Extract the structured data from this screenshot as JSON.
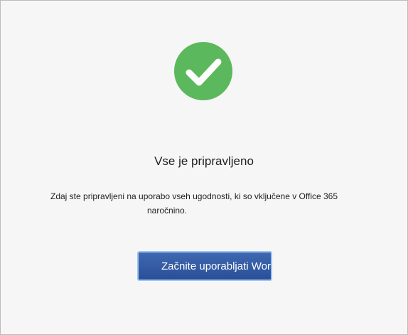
{
  "dialog": {
    "title": "Vse je pripravljeno",
    "message_line1": "Zdaj ste pripravljeni na uporabo vseh ugodnosti, ki so vključene v Office 365",
    "message_line2": "naročnino.",
    "start_button_label": "Začnite uporabljati Word"
  },
  "icons": {
    "status": "checkmark-circle-icon"
  },
  "colors": {
    "success": "#5cb85c",
    "button": "#2f57a2",
    "button_border": "#9ec6f2"
  }
}
